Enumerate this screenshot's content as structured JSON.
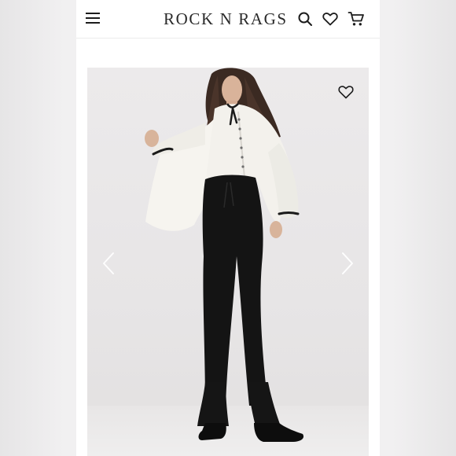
{
  "header": {
    "brand": "ROCK N RAGS",
    "icons": [
      "menu-icon",
      "search-icon",
      "heart-icon",
      "cart-icon"
    ]
  },
  "product_image": {
    "icons": [
      "heart-outline-icon",
      "chevron-left-icon",
      "chevron-right-icon"
    ]
  },
  "colors": {
    "header_text": "#2a2a2a",
    "icon": "#1c1c1c",
    "background": "#f1f0f1"
  }
}
